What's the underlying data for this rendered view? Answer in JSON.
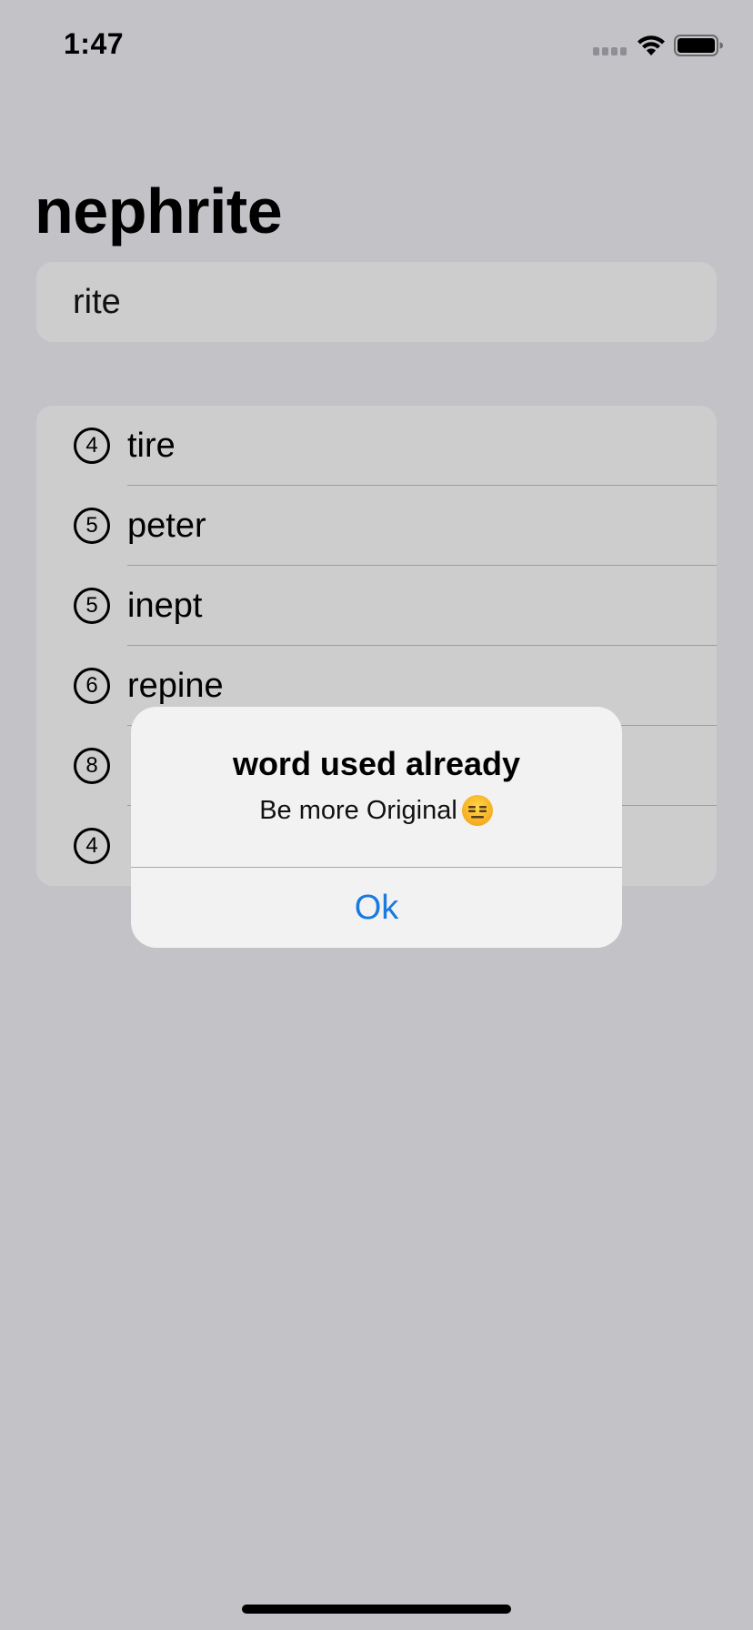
{
  "status_bar": {
    "time": "1:47"
  },
  "header": {
    "title": "nephrite"
  },
  "input": {
    "value": "rite"
  },
  "words": [
    {
      "count": "4",
      "word": "tire"
    },
    {
      "count": "5",
      "word": "peter"
    },
    {
      "count": "5",
      "word": "inept"
    },
    {
      "count": "6",
      "word": "repine"
    },
    {
      "count": "8",
      "word": ""
    },
    {
      "count": "4",
      "word": ""
    }
  ],
  "alert": {
    "title": "word used already",
    "message": "Be more Original",
    "emoji": "expressionless-face",
    "ok_label": "Ok"
  },
  "colors": {
    "background": "#c3c2c7",
    "card": "#cdcdcd",
    "alert_bg": "#f2f2f2",
    "accent": "#1a7ae0"
  }
}
